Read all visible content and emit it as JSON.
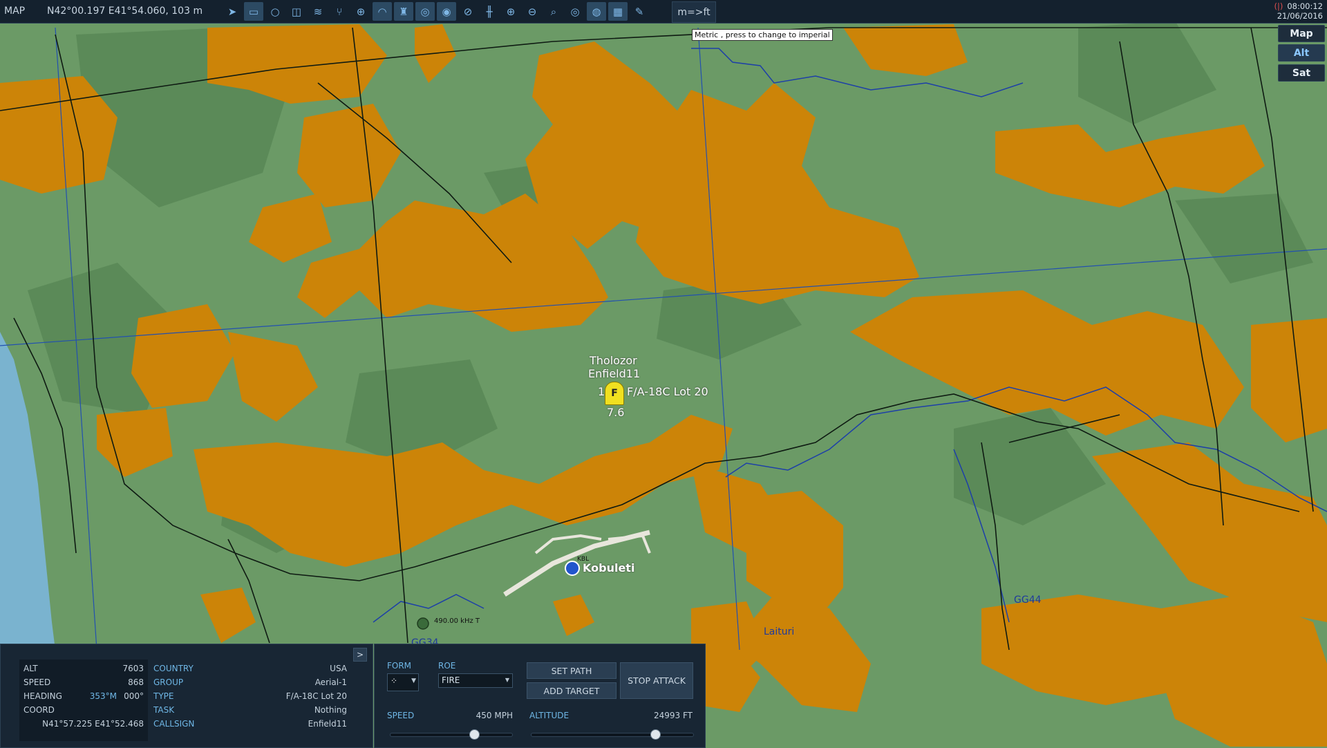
{
  "topbar": {
    "mode_label": "MAP",
    "cursor_coords": "N42°00.197 E41°54.060, 103 m",
    "unit_toggle": "m=>ft",
    "unit_tooltip": "Metric , press to change to imperial",
    "time": "08:00:12",
    "date": "21/06/2016",
    "signal_icon": "signal-strength-icon",
    "tools": [
      "navigate-icon",
      "measure-icon",
      "circle-icon",
      "layers-icon",
      "road-icon",
      "split-icon",
      "crosshair-icon",
      "wifi-icon",
      "tower-icon",
      "radar-icon",
      "radar-alt-icon",
      "radar-off-icon",
      "ruler-icon",
      "zoom-in-icon",
      "zoom-out-icon",
      "zoom-fit-icon",
      "target-icon",
      "globe-icon",
      "grid-icon",
      "pencil-icon"
    ]
  },
  "map_types": {
    "map": "Map",
    "alt": "Alt",
    "sat": "Sat",
    "active": "Alt"
  },
  "unit": {
    "player": "Tholozor",
    "callsign": "Enfield11",
    "count": "1",
    "symbol": "F",
    "type": "F/A-18C Lot 20",
    "altitude_label": "7.6"
  },
  "map_labels": {
    "airfield": "Kobuleti",
    "airfield_code": "KBL",
    "ndb": "490.00 kHz T",
    "grid_left": "GG34",
    "grid_right": "GG44",
    "village": "Laituri"
  },
  "info_panel": {
    "alt_label": "ALT",
    "alt": "7603",
    "speed_label": "SPEED",
    "speed": "868",
    "heading_label": "HEADING",
    "heading_mag": "353°M",
    "heading_true": "000°",
    "coord_label": "COORD",
    "coord": "N41°57.225 E41°52.468",
    "country_label": "COUNTRY",
    "country": "USA",
    "group_label": "GROUP",
    "group": "Aerial-1",
    "type_label": "TYPE",
    "type": "F/A-18C Lot 20",
    "task_label": "TASK",
    "task": "Nothing",
    "callsign_label": "CALLSIGN",
    "callsign": "Enfield11",
    "expand": ">"
  },
  "control_panel": {
    "form_label": "FORM",
    "roe_label": "ROE",
    "roe_value": "FIRE",
    "set_path": "SET PATH",
    "add_target": "ADD TARGET",
    "stop_attack": "STOP ATTACK",
    "speed_label": "SPEED",
    "speed_value": "450 MPH",
    "speed_fraction": 0.68,
    "altitude_label": "ALTITUDE",
    "altitude_value": "24993 FT",
    "altitude_fraction": 0.76
  },
  "colors": {
    "terrain_light": "#6b9a66",
    "terrain_dark": "#5c8a5a",
    "urban": "#cc8408",
    "sea": "#7ab3cf",
    "road": "#0e1a12",
    "grid_line": "#2250b0",
    "river": "#1d3fa8",
    "unit_marker": "#f0e020"
  }
}
